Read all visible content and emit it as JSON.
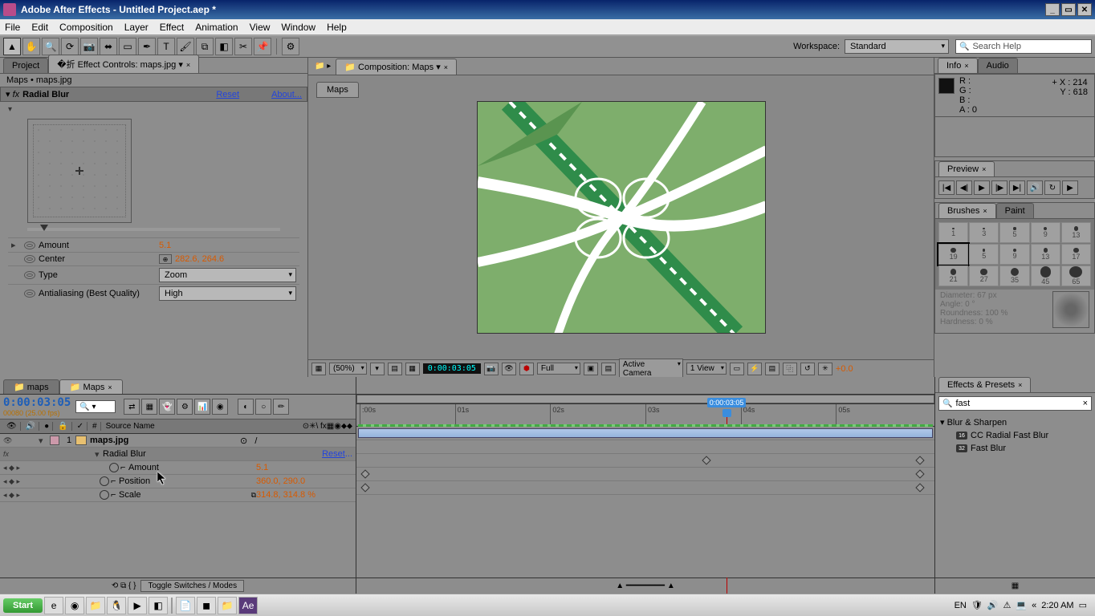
{
  "title": "Adobe After Effects - Untitled Project.aep *",
  "menu": [
    "File",
    "Edit",
    "Composition",
    "Layer",
    "Effect",
    "Animation",
    "View",
    "Window",
    "Help"
  ],
  "workspace_label": "Workspace:",
  "workspace_value": "Standard",
  "search_help_placeholder": "Search Help",
  "left_panel": {
    "tabs": {
      "project": "Project",
      "effect_controls": "Effect Controls: maps.jpg"
    },
    "breadcrumb": "Maps • maps.jpg",
    "effect": {
      "name": "Radial Blur",
      "reset": "Reset",
      "about": "About...",
      "props": {
        "amount": {
          "label": "Amount",
          "value": "5.1"
        },
        "center": {
          "label": "Center",
          "value": "282.6, 264.6"
        },
        "type": {
          "label": "Type",
          "value": "Zoom"
        },
        "antialias": {
          "label": "Antialiasing (Best Quality)",
          "value": "High"
        }
      }
    }
  },
  "comp_panel": {
    "tab": "Composition: Maps",
    "nested_tab": "Maps",
    "footer": {
      "zoom": "(50%)",
      "time": "0:00:03:05",
      "channel": "Full",
      "camera": "Active Camera",
      "views": "1 View",
      "exposure": "+0.0"
    }
  },
  "info_panel": {
    "tabs": {
      "info": "Info",
      "audio": "Audio"
    },
    "R": "R :",
    "G": "G :",
    "B": "B :",
    "A": "A : 0",
    "X": "X : 214",
    "Y": "Y : 618"
  },
  "preview_panel": {
    "tab": "Preview"
  },
  "brushes_panel": {
    "tabs": {
      "brushes": "Brushes",
      "paint": "Paint"
    },
    "sizes": [
      [
        "1",
        "3",
        "5",
        "9",
        "13"
      ],
      [
        "19",
        "5",
        "9",
        "13",
        "17"
      ],
      [
        "21",
        "27",
        "35",
        "45",
        "65"
      ]
    ],
    "diameter": "Diameter: 67 px",
    "angle": "Angle: 0 °",
    "roundness": "Roundness: 100 %",
    "hardness": "Hardness: 0 %"
  },
  "timeline": {
    "tabs": {
      "maps_l": "maps",
      "maps_u": "Maps"
    },
    "time": "0:00:03:05",
    "fps": "00080 (25.00 fps)",
    "col_header": "Source Name",
    "layer": {
      "num": "1",
      "name": "maps.jpg"
    },
    "fx": {
      "name": "Radial Blur",
      "reset": "Reset",
      "ellipsis": "..."
    },
    "props": {
      "amount": {
        "label": "Amount",
        "value": "5.1"
      },
      "position": {
        "label": "Position",
        "value": "360.0, 290.0"
      },
      "scale": {
        "label": "Scale",
        "value": "314.8, 314.8 %"
      }
    },
    "ruler": [
      ":00s",
      "01s",
      "02s",
      "03s",
      "04s",
      "05s"
    ],
    "footer_label": "Toggle Switches / Modes"
  },
  "effects_presets": {
    "tab": "Effects & Presets",
    "search": "fast",
    "category": "Blur & Sharpen",
    "items": [
      "CC Radial Fast Blur",
      "Fast Blur"
    ]
  },
  "taskbar": {
    "start": "Start",
    "lang": "EN",
    "time": "2:20 AM"
  }
}
